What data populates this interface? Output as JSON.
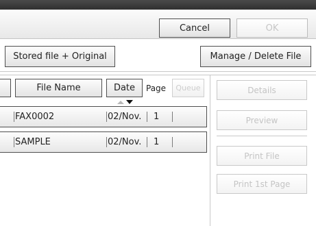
{
  "top_buttons": {
    "cancel": "Cancel",
    "ok": "OK"
  },
  "toolbar": {
    "stored_file": "Stored file + Original",
    "manage": "Manage / Delete File"
  },
  "columns": {
    "file_name": "File Name",
    "date": "Date",
    "page": "Page",
    "queue": "Queue"
  },
  "rows": [
    {
      "name": "FAX0002",
      "date": "02/Nov.",
      "page": "1"
    },
    {
      "name": "SAMPLE",
      "date": "02/Nov.",
      "page": "1"
    }
  ],
  "side_buttons": {
    "details": "Details",
    "preview": "Preview",
    "print_file": "Print File",
    "print_first": "Print 1st Page"
  },
  "sort_icons": {
    "up": "sort-ascending-icon",
    "down": "sort-descending-icon"
  }
}
